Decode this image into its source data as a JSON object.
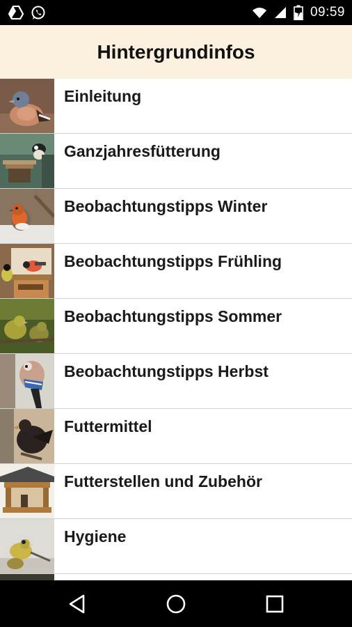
{
  "statusbar": {
    "time": "09:59",
    "left_icons": [
      "drive-icon",
      "whatsapp-icon"
    ],
    "right_icons": [
      "wifi-icon",
      "cell-signal-icon",
      "battery-charging-icon"
    ]
  },
  "appbar": {
    "title": "Hintergrundinfos"
  },
  "list": {
    "items": [
      {
        "label": "Einleitung",
        "thumb": "chaffinch-photo"
      },
      {
        "label": "Ganzjahresfütterung",
        "thumb": "tit-feeder-photo"
      },
      {
        "label": "Beobachtungstipps Winter",
        "thumb": "robin-snow-photo"
      },
      {
        "label": "Beobachtungstipps Frühling",
        "thumb": "bullfinch-feeder-photo"
      },
      {
        "label": "Beobachtungstipps Sommer",
        "thumb": "greenfinch-photo"
      },
      {
        "label": "Beobachtungstipps Herbst",
        "thumb": "jay-photo"
      },
      {
        "label": "Futtermittel",
        "thumb": "blackbird-photo"
      },
      {
        "label": "Futterstellen und Zubehör",
        "thumb": "birdhouse-feeder-photo"
      },
      {
        "label": "Hygiene",
        "thumb": "siskin-photo"
      }
    ]
  },
  "navbar": {
    "buttons": [
      "back-icon",
      "home-icon",
      "recents-icon"
    ]
  },
  "colors": {
    "appbar_bg": "#fbf1de",
    "divider": "#cfcfcf",
    "status_bg": "#000000"
  }
}
